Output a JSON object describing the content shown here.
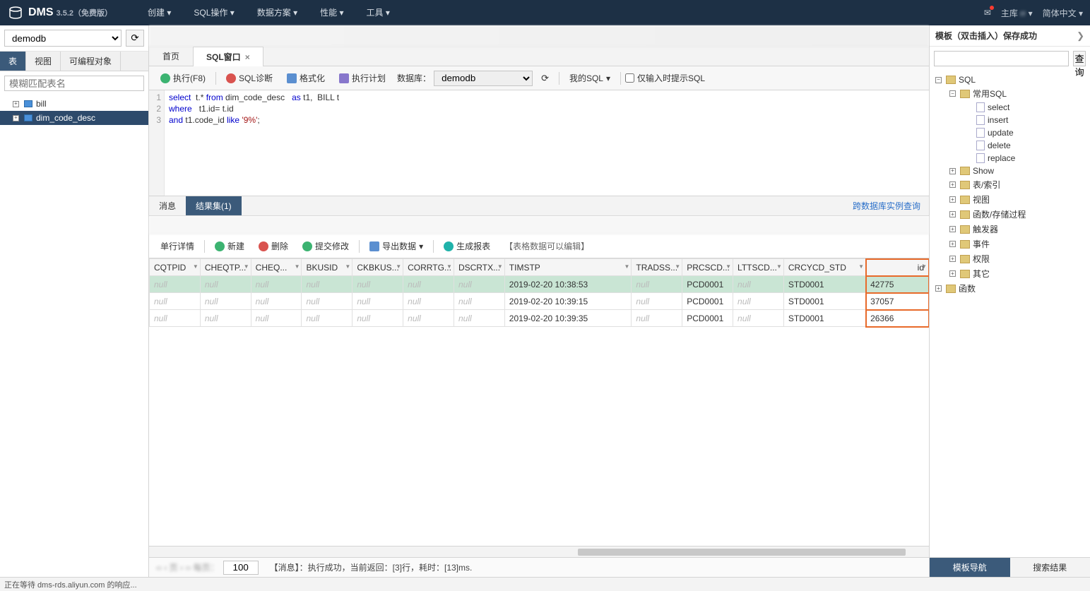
{
  "header": {
    "logo": "DMS",
    "version": "3.5.2（免费版）",
    "menu": [
      "创建",
      "SQL操作",
      "数据方案",
      "性能",
      "工具"
    ],
    "host_label": "主库",
    "host_value": "rr",
    "lang": "简体中文"
  },
  "left": {
    "db": "demodb",
    "tabs": [
      "表",
      "视图",
      "可编程对象"
    ],
    "search_placeholder": "模糊匹配表名",
    "tables": [
      "bill",
      "dim_code_desc"
    ],
    "selected_index": 1
  },
  "center": {
    "tabs": [
      {
        "label": "首页",
        "active": false,
        "closable": false
      },
      {
        "label": "SQL窗口",
        "active": true,
        "closable": true
      }
    ],
    "toolbar": {
      "execute": "执行(F8)",
      "diag": "SQL诊断",
      "format": "格式化",
      "plan": "执行计划",
      "db_label": "数据库：",
      "db_value": "demodb",
      "my_sql": "我的SQL",
      "hint_only": "仅输入时提示SQL"
    },
    "sql_lines": [
      {
        "n": "1",
        "html": "<span class='kw'>select</span>  t.* <span class='kw'>from</span> dim_code_desc   <span class='kw'>as</span> t1,  BILL t"
      },
      {
        "n": "2",
        "html": "<span class='kw'>where</span>   t1.id= t.id"
      },
      {
        "n": "3",
        "html": "<span class='kw'>and</span> t1.code_id <span class='kw'>like</span> <span class='str'>'9%'</span>;"
      }
    ],
    "result_tabs": {
      "msg": "消息",
      "set": "结果集(1)",
      "cross": "跨数据库实例查询"
    },
    "result_toolbar": {
      "detail": "单行详情",
      "add": "新建",
      "del": "删除",
      "commit": "提交修改",
      "export": "导出数据",
      "report": "生成报表",
      "hint": "【表格数据可以编辑】"
    },
    "columns": [
      "CQTPID",
      "CHEQTP...",
      "CHEQ...",
      "BKUSID",
      "CKBKUS...",
      "CORRTG...",
      "DSCRTX...",
      "TIMSTP",
      "TRADSS...",
      "PRCSCD...",
      "LTTSCD...",
      "CRCYCD_STD",
      "id"
    ],
    "rows": [
      {
        "TIMSTP": "2019-02-20 10:38:53",
        "PRCSCD": "PCD0001",
        "CRCYCD_STD": "STD0001",
        "id": "42775"
      },
      {
        "TIMSTP": "2019-02-20 10:39:15",
        "PRCSCD": "PCD0001",
        "CRCYCD_STD": "STD0001",
        "id": "37057"
      },
      {
        "TIMSTP": "2019-02-20 10:39:35",
        "PRCSCD": "PCD0001",
        "CRCYCD_STD": "STD0001",
        "id": "26366"
      }
    ],
    "null_text": "null",
    "pager": {
      "size": "100",
      "msg": "【消息】：执行成功，当前返回：[3]行，耗时：[13]ms."
    }
  },
  "right": {
    "title": "模板（双击插入）保存成功",
    "search_btn": "查询",
    "tree": {
      "root": "SQL",
      "nodes": [
        {
          "label": "常用SQL",
          "type": "folder",
          "children": [
            "select",
            "insert",
            "update",
            "delete",
            "replace"
          ]
        },
        {
          "label": "Show",
          "type": "folder"
        },
        {
          "label": "表/索引",
          "type": "folder"
        },
        {
          "label": "视图",
          "type": "folder"
        },
        {
          "label": "函数/存储过程",
          "type": "folder"
        },
        {
          "label": "触发器",
          "type": "folder"
        },
        {
          "label": "事件",
          "type": "folder"
        },
        {
          "label": "权限",
          "type": "folder"
        },
        {
          "label": "其它",
          "type": "folder"
        }
      ],
      "root2": "函数"
    },
    "bottom_tabs": [
      "模板导航",
      "搜索结果"
    ]
  },
  "status": "正在等待 dms-rds.aliyun.com 的响应..."
}
